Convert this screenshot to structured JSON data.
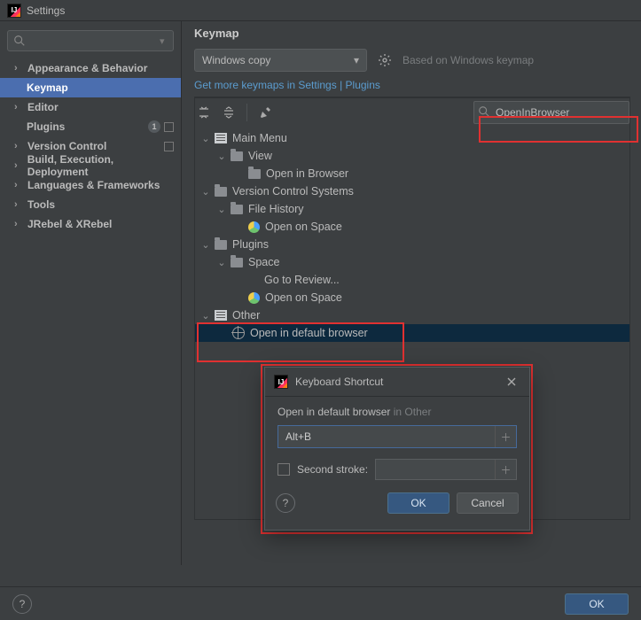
{
  "title": "Settings",
  "sidebar": {
    "items": [
      {
        "label": "Appearance & Behavior",
        "expandable": true
      },
      {
        "label": "Keymap",
        "selected": true
      },
      {
        "label": "Editor",
        "expandable": true
      },
      {
        "label": "Plugins",
        "badge": "1"
      },
      {
        "label": "Version Control",
        "expandable": true,
        "sepbadge": true
      },
      {
        "label": "Build, Execution, Deployment",
        "expandable": true
      },
      {
        "label": "Languages & Frameworks",
        "expandable": true
      },
      {
        "label": "Tools",
        "expandable": true
      },
      {
        "label": "JRebel & XRebel",
        "expandable": true
      }
    ]
  },
  "panel": {
    "heading": "Keymap",
    "scheme": "Windows copy",
    "based": "Based on Windows keymap",
    "link1": "Get more keymaps in Settings | Plugins",
    "filter_value": "OpenInBrowser"
  },
  "tree": {
    "main_menu": "Main Menu",
    "view": "View",
    "open_in_browser": "Open in Browser",
    "vcs": "Version Control Systems",
    "file_history": "File History",
    "open_on_space": "Open on Space",
    "plugins": "Plugins",
    "space": "Space",
    "goto_review": "Go to Review...",
    "open_on_space2": "Open on Space",
    "other": "Other",
    "open_default": "Open in default browser"
  },
  "dialog": {
    "title": "Keyboard Shortcut",
    "action": "Open in default browser",
    "context": "in Other",
    "shortcut": "Alt+B",
    "second": "Second stroke:",
    "ok": "OK",
    "cancel": "Cancel"
  },
  "bottom": {
    "ok": "OK"
  }
}
